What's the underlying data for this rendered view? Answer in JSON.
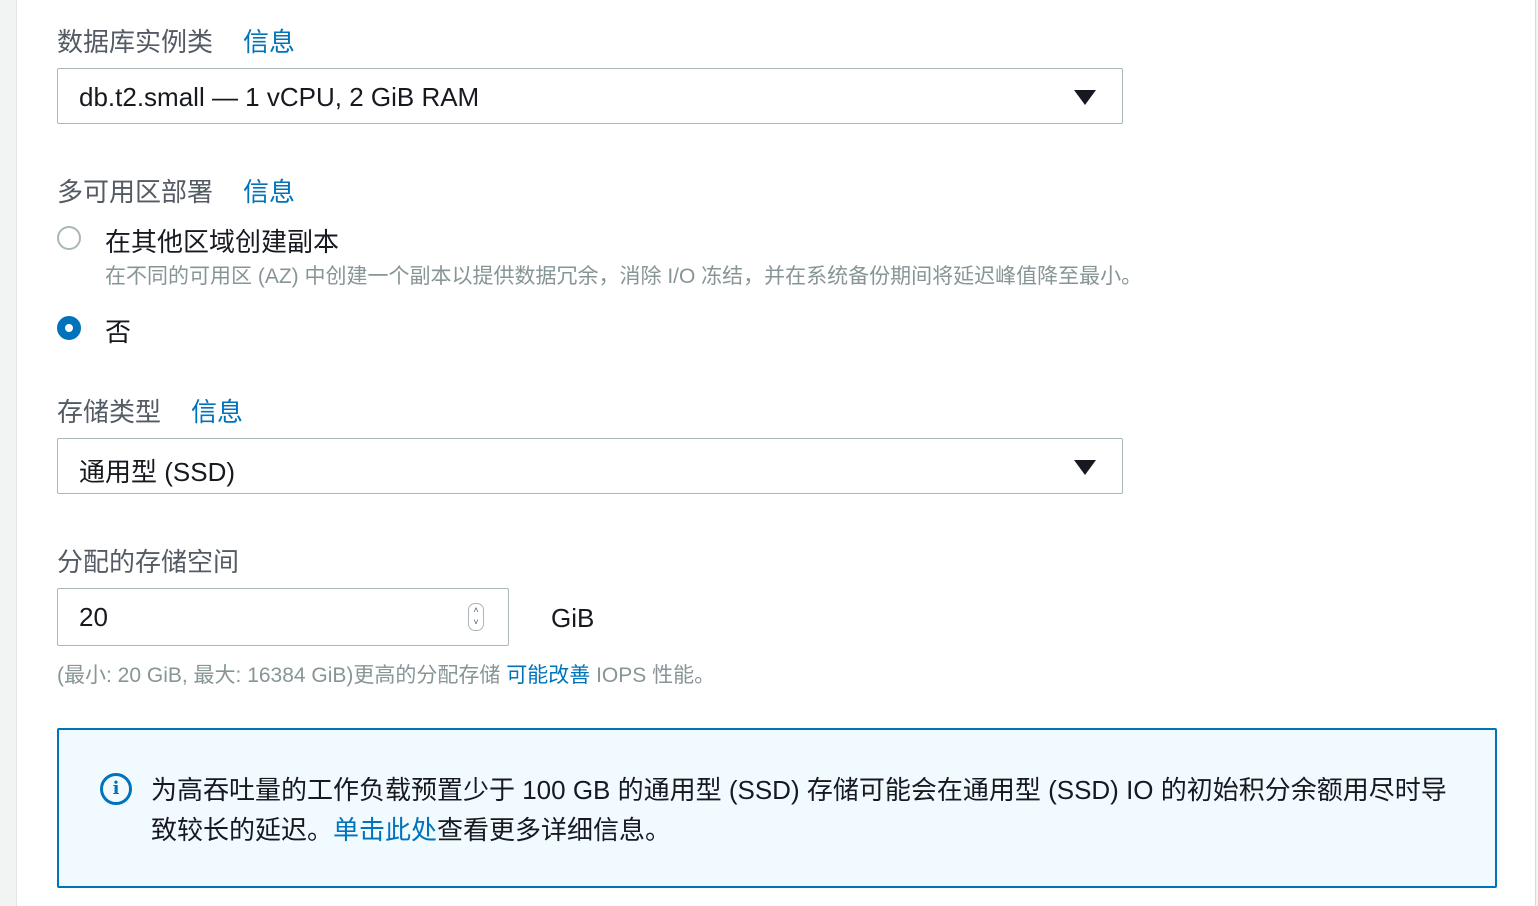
{
  "instance_class": {
    "label": "数据库实例类",
    "info": "信息",
    "value": "db.t2.small — 1 vCPU, 2 GiB RAM"
  },
  "multi_az": {
    "label": "多可用区部署",
    "info": "信息",
    "options": [
      {
        "label": "在其他区域创建副本",
        "description": "在不同的可用区 (AZ) 中创建一个副本以提供数据冗余，消除 I/O 冻结，并在系统备份期间将延迟峰值降至最小。",
        "selected": false
      },
      {
        "label": "否",
        "selected": true
      }
    ]
  },
  "storage_type": {
    "label": "存储类型",
    "info": "信息",
    "value": "通用型 (SSD)"
  },
  "allocated_storage": {
    "label": "分配的存储空间",
    "value": "20",
    "unit": "GiB",
    "hint_prefix": "(最小: 20 GiB, 最大: 16384 GiB)更高的分配存储 ",
    "hint_link": "可能改善",
    "hint_suffix": " IOPS 性能。"
  },
  "alert": {
    "icon": "info-circle-icon",
    "text_prefix": "为高吞吐量的工作负载预置少于 100 GB 的通用型 (SSD) 存储可能会在通用型 (SSD) IO 的初始积分余额用尽时导致较长的延迟。",
    "link": "单击此处",
    "text_suffix": "查看更多详细信息。"
  },
  "colors": {
    "accent": "#0073bb",
    "alert_bg": "#f1faff"
  }
}
